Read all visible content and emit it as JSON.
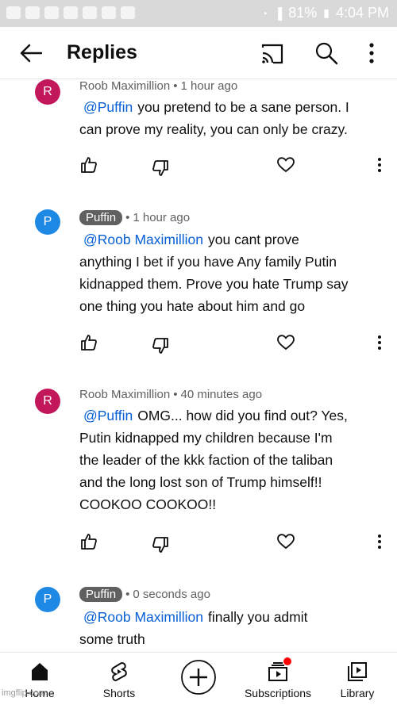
{
  "status_bar": {
    "battery": "81%",
    "time": "4:04 PM"
  },
  "header": {
    "title": "Replies"
  },
  "comments": [
    {
      "initial": "R",
      "avatar_color": "#c2185b",
      "author": "Roob Maximillion",
      "time": "1 hour ago",
      "is_owner_chip": false,
      "mention": "@Puffin",
      "lines": [
        "you pretend to be a sane person.  I",
        "can prove my reality, you can only be crazy."
      ]
    },
    {
      "initial": "P",
      "avatar_color": "#1e88e5",
      "author": "Puffin",
      "time": "1 hour ago",
      "is_owner_chip": true,
      "mention": "@Roob Maximillion",
      "lines": [
        "you cant prove",
        "anything I bet if you have Any family Putin",
        "kidnapped them. Prove you hate Trump say",
        "one thing you hate about him and go"
      ]
    },
    {
      "initial": "R",
      "avatar_color": "#c2185b",
      "author": "Roob Maximillion",
      "time": "40 minutes ago",
      "is_owner_chip": false,
      "mention": "@Puffin",
      "lines": [
        "OMG... how did you find out?  Yes,",
        "Putin kidnapped my children because I'm",
        "the leader of the kkk faction of the taliban",
        "and the long lost son of Trump himself!!",
        "COOKOO COOKOO!!"
      ]
    },
    {
      "initial": "P",
      "avatar_color": "#1e88e5",
      "author": "Puffin",
      "time": "0 seconds ago",
      "is_owner_chip": true,
      "mention": "@Roob Maximillion",
      "lines": [
        "finally you admit",
        "some truth"
      ]
    }
  ],
  "bottom_nav": {
    "home": "Home",
    "shorts": "Shorts",
    "subscriptions": "Subscriptions",
    "library": "Library"
  },
  "watermark": "imgflip.com"
}
